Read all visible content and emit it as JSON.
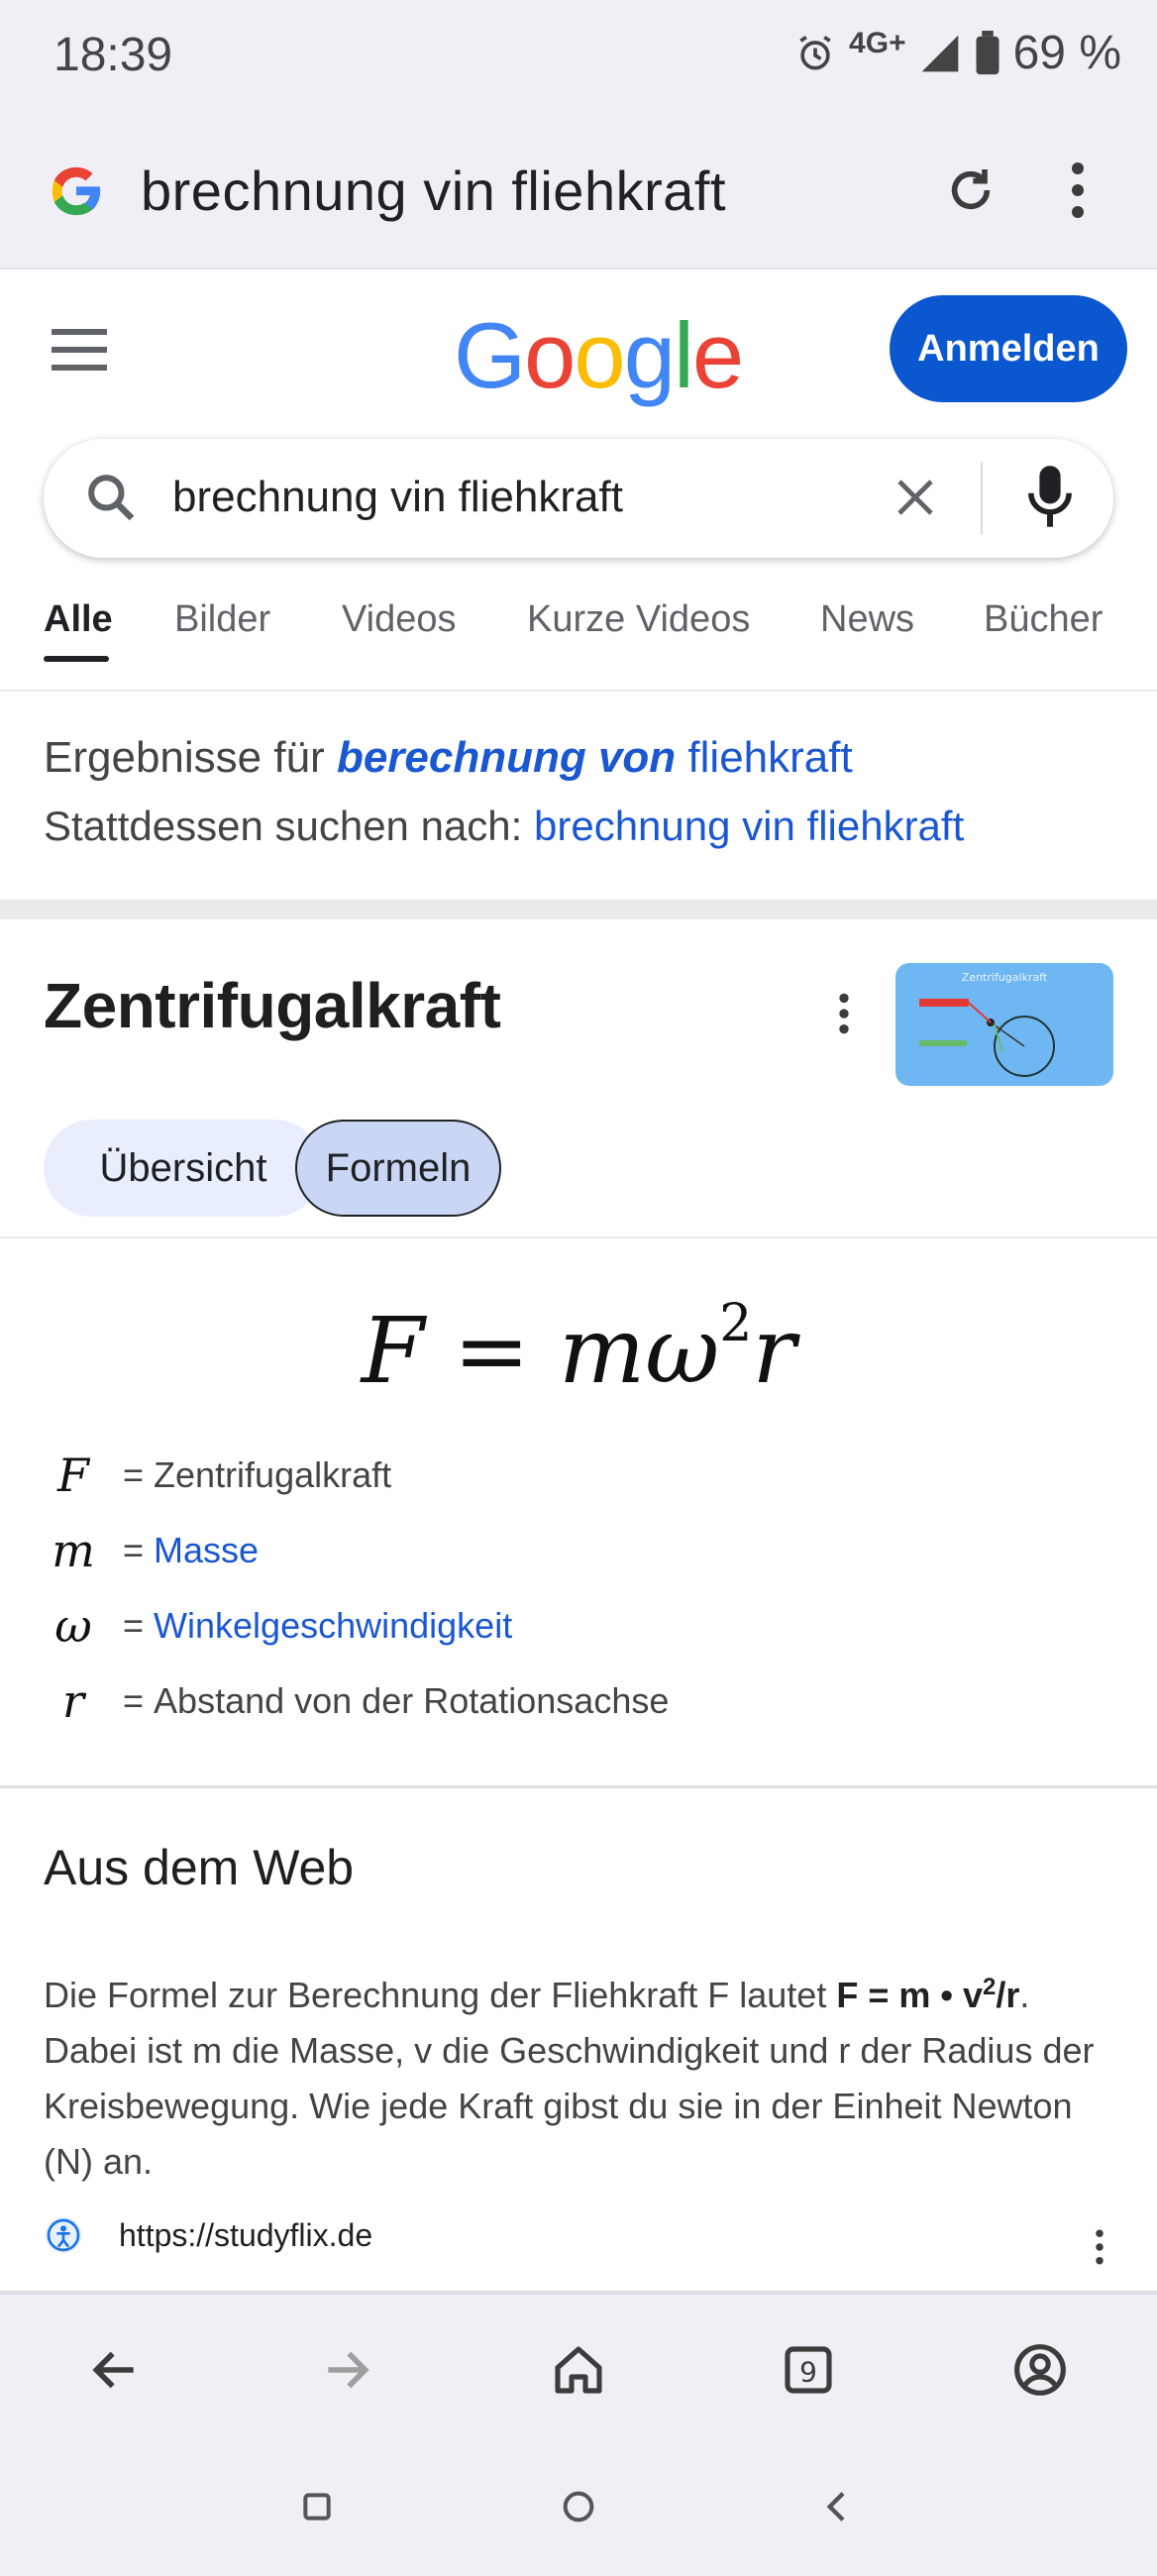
{
  "status": {
    "time": "18:39",
    "network": "4G+",
    "battery": "69 %"
  },
  "browser": {
    "url_text": "brechnung vin fliehkraft"
  },
  "header": {
    "logo_text": "Google",
    "signin_label": "Anmelden"
  },
  "search": {
    "query": "brechnung vin fliehkraft",
    "placeholder": ""
  },
  "tabs": [
    {
      "label": "Alle",
      "active": true
    },
    {
      "label": "Bilder"
    },
    {
      "label": "Videos"
    },
    {
      "label": "Kurze Videos"
    },
    {
      "label": "News"
    },
    {
      "label": "Bücher"
    }
  ],
  "correction": {
    "prefix": "Ergebnisse für ",
    "corrected": "berechnung von",
    "rest": " fliehkraft",
    "instead_prefix": "Stattdessen suchen nach: ",
    "instead_link": "brechnung vin fliehkraft"
  },
  "knowledge": {
    "title": "Zentrifugalkraft",
    "thumb_caption": "Zentrifugalkraft",
    "chips": [
      "Übersicht",
      "Formeln"
    ],
    "formula": {
      "lhs": "F",
      "eq": " = ",
      "rhs_base": "mω",
      "exponent": "2",
      "rhs_tail": "r"
    },
    "definitions": [
      {
        "symbol": "F",
        "eq": "=",
        "text": "Zentrifugalkraft",
        "link": false
      },
      {
        "symbol": "m",
        "eq": "=",
        "text": "Masse",
        "link": true
      },
      {
        "symbol": "ω",
        "eq": "=",
        "text": "Winkelgeschwindigkeit",
        "link": true
      },
      {
        "symbol": "r",
        "eq": "=",
        "text": "Abstand von der Rotationsachse",
        "link": false
      }
    ]
  },
  "web": {
    "title": "Aus dem Web",
    "snippet_a": "Die Formel zur Berechnung der Fliehkraft F lautet ",
    "snippet_bold": "F = m • v",
    "snippet_sup": "2",
    "snippet_bold2": "/r",
    "snippet_b": ". Dabei ist m die Masse, v die Geschwindigkeit und r der Radius der Kreisbewegung. Wie jede Kraft gibst du sie in der Einheit Newton (N) an.",
    "source_url": "https://studyflix.de"
  },
  "bottom_nav": {
    "tab_count": "9"
  },
  "colors": {
    "accent": "#0b57d0",
    "link": "#1a57d0",
    "chrome_bg": "#f1eff6"
  }
}
